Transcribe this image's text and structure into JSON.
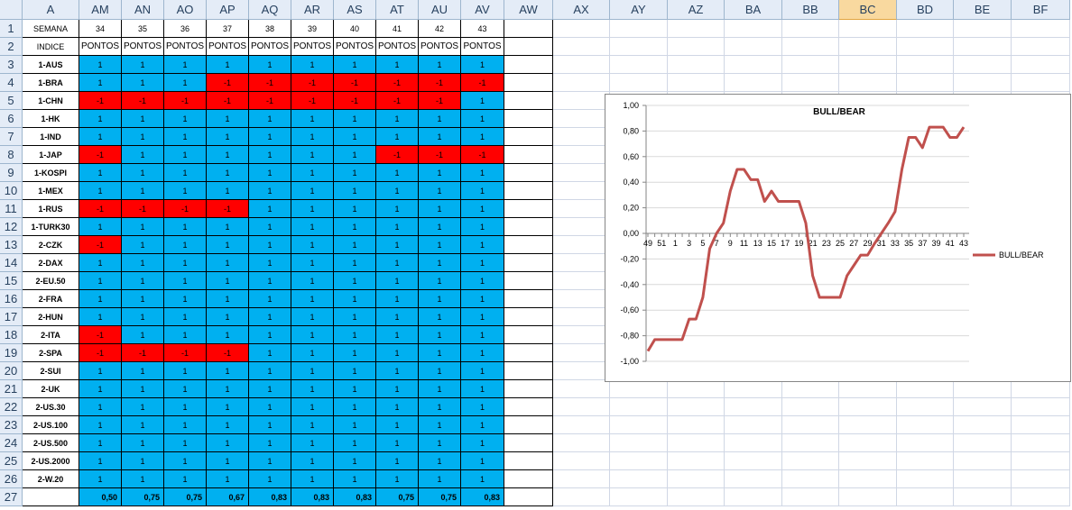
{
  "column_headers": [
    "A",
    "AM",
    "AN",
    "AO",
    "AP",
    "AQ",
    "AR",
    "AS",
    "AT",
    "AU",
    "AV",
    "AW",
    "AX",
    "AY",
    "AZ",
    "BA",
    "BB",
    "BC",
    "BD",
    "BE",
    "BF"
  ],
  "selected_column": "BC",
  "row_numbers": [
    "1",
    "2",
    "3",
    "4",
    "5",
    "6",
    "7",
    "8",
    "9",
    "10",
    "11",
    "12",
    "13",
    "14",
    "15",
    "16",
    "17",
    "18",
    "19",
    "20",
    "21",
    "22",
    "23",
    "24",
    "25",
    "26",
    "27"
  ],
  "row1": {
    "label": "SEMANA",
    "weeks": [
      "34",
      "35",
      "36",
      "37",
      "38",
      "39",
      "40",
      "41",
      "42",
      "43"
    ]
  },
  "row2": {
    "label": "INDICE",
    "headers": [
      "PONTOS",
      "PONTOS",
      "PONTOS",
      "PONTOS",
      "PONTOS",
      "PONTOS",
      "PONTOS",
      "PONTOS",
      "PONTOS",
      "PONTOS"
    ]
  },
  "indices": [
    {
      "name": "1-AUS",
      "values": [
        "1",
        "1",
        "1",
        "1",
        "1",
        "1",
        "1",
        "1",
        "1",
        "1"
      ]
    },
    {
      "name": "1-BRA",
      "values": [
        "1",
        "1",
        "1",
        "-1",
        "-1",
        "-1",
        "-1",
        "-1",
        "-1",
        "-1"
      ]
    },
    {
      "name": "1-CHN",
      "values": [
        "-1",
        "-1",
        "-1",
        "-1",
        "-1",
        "-1",
        "-1",
        "-1",
        "-1",
        "1"
      ]
    },
    {
      "name": "1-HK",
      "values": [
        "1",
        "1",
        "1",
        "1",
        "1",
        "1",
        "1",
        "1",
        "1",
        "1"
      ]
    },
    {
      "name": "1-IND",
      "values": [
        "1",
        "1",
        "1",
        "1",
        "1",
        "1",
        "1",
        "1",
        "1",
        "1"
      ]
    },
    {
      "name": "1-JAP",
      "values": [
        "-1",
        "1",
        "1",
        "1",
        "1",
        "1",
        "1",
        "-1",
        "-1",
        "-1"
      ]
    },
    {
      "name": "1-KOSPI",
      "values": [
        "1",
        "1",
        "1",
        "1",
        "1",
        "1",
        "1",
        "1",
        "1",
        "1"
      ]
    },
    {
      "name": "1-MEX",
      "values": [
        "1",
        "1",
        "1",
        "1",
        "1",
        "1",
        "1",
        "1",
        "1",
        "1"
      ]
    },
    {
      "name": "1-RUS",
      "values": [
        "-1",
        "-1",
        "-1",
        "-1",
        "1",
        "1",
        "1",
        "1",
        "1",
        "1"
      ]
    },
    {
      "name": "1-TURK30",
      "values": [
        "1",
        "1",
        "1",
        "1",
        "1",
        "1",
        "1",
        "1",
        "1",
        "1"
      ]
    },
    {
      "name": "2-CZK",
      "values": [
        "-1",
        "1",
        "1",
        "1",
        "1",
        "1",
        "1",
        "1",
        "1",
        "1"
      ]
    },
    {
      "name": "2-DAX",
      "values": [
        "1",
        "1",
        "1",
        "1",
        "1",
        "1",
        "1",
        "1",
        "1",
        "1"
      ]
    },
    {
      "name": "2-EU.50",
      "values": [
        "1",
        "1",
        "1",
        "1",
        "1",
        "1",
        "1",
        "1",
        "1",
        "1"
      ]
    },
    {
      "name": "2-FRA",
      "values": [
        "1",
        "1",
        "1",
        "1",
        "1",
        "1",
        "1",
        "1",
        "1",
        "1"
      ]
    },
    {
      "name": "2-HUN",
      "values": [
        "1",
        "1",
        "1",
        "1",
        "1",
        "1",
        "1",
        "1",
        "1",
        "1"
      ]
    },
    {
      "name": "2-ITA",
      "values": [
        "-1",
        "1",
        "1",
        "1",
        "1",
        "1",
        "1",
        "1",
        "1",
        "1"
      ]
    },
    {
      "name": "2-SPA",
      "values": [
        "-1",
        "-1",
        "-1",
        "-1",
        "1",
        "1",
        "1",
        "1",
        "1",
        "1"
      ]
    },
    {
      "name": "2-SUI",
      "values": [
        "1",
        "1",
        "1",
        "1",
        "1",
        "1",
        "1",
        "1",
        "1",
        "1"
      ]
    },
    {
      "name": "2-UK",
      "values": [
        "1",
        "1",
        "1",
        "1",
        "1",
        "1",
        "1",
        "1",
        "1",
        "1"
      ]
    },
    {
      "name": "2-US.30",
      "values": [
        "1",
        "1",
        "1",
        "1",
        "1",
        "1",
        "1",
        "1",
        "1",
        "1"
      ]
    },
    {
      "name": "2-US.100",
      "values": [
        "1",
        "1",
        "1",
        "1",
        "1",
        "1",
        "1",
        "1",
        "1",
        "1"
      ]
    },
    {
      "name": "2-US.500",
      "values": [
        "1",
        "1",
        "1",
        "1",
        "1",
        "1",
        "1",
        "1",
        "1",
        "1"
      ]
    },
    {
      "name": "2-US.2000",
      "values": [
        "1",
        "1",
        "1",
        "1",
        "1",
        "1",
        "1",
        "1",
        "1",
        "1"
      ]
    },
    {
      "name": "2-W.20",
      "values": [
        "1",
        "1",
        "1",
        "1",
        "1",
        "1",
        "1",
        "1",
        "1",
        "1"
      ]
    }
  ],
  "totals": [
    "0,50",
    "0,75",
    "0,75",
    "0,67",
    "0,83",
    "0,83",
    "0,83",
    "0,75",
    "0,75",
    "0,83"
  ],
  "colors": {
    "positive": "#00b0f0",
    "negative": "#ff0000",
    "series_line": "#c0504d",
    "selected_header": "#f9d99f"
  },
  "chart_data": {
    "type": "line",
    "title": "BULL/BEAR",
    "legend": "right",
    "ylim": [
      -1.0,
      1.0
    ],
    "ytick_step": 0.2,
    "y_tick_labels": [
      "1,00",
      "0,80",
      "0,60",
      "0,40",
      "0,20",
      "0,00",
      "-0,20",
      "-0,40",
      "-0,60",
      "-0,80",
      "-1,00"
    ],
    "x_tick_labels": [
      "49",
      "51",
      "1",
      "3",
      "5",
      "7",
      "9",
      "11",
      "13",
      "15",
      "17",
      "19",
      "21",
      "23",
      "25",
      "27",
      "29",
      "31",
      "33",
      "35",
      "37",
      "39",
      "41",
      "43"
    ],
    "series": [
      {
        "name": "BULL/BEAR",
        "x": [
          "49",
          "50",
          "51",
          "52",
          "1",
          "2",
          "3",
          "4",
          "5",
          "6",
          "7",
          "8",
          "9",
          "10",
          "11",
          "12",
          "13",
          "14",
          "15",
          "16",
          "17",
          "18",
          "19",
          "20",
          "21",
          "22",
          "23",
          "24",
          "25",
          "26",
          "27",
          "28",
          "29",
          "30",
          "31",
          "32",
          "33",
          "34",
          "35",
          "36",
          "37",
          "38",
          "39",
          "40",
          "41",
          "42",
          "43"
        ],
        "values": [
          -0.92,
          -0.83,
          -0.83,
          -0.83,
          -0.83,
          -0.83,
          -0.67,
          -0.67,
          -0.5,
          -0.12,
          0.0,
          0.08,
          0.33,
          0.5,
          0.5,
          0.42,
          0.42,
          0.25,
          0.33,
          0.25,
          0.25,
          0.25,
          0.25,
          0.08,
          -0.33,
          -0.5,
          -0.5,
          -0.5,
          -0.5,
          -0.33,
          -0.25,
          -0.17,
          -0.17,
          -0.08,
          0.0,
          0.08,
          0.17,
          0.5,
          0.75,
          0.75,
          0.67,
          0.83,
          0.83,
          0.83,
          0.75,
          0.75,
          0.83
        ]
      }
    ]
  }
}
